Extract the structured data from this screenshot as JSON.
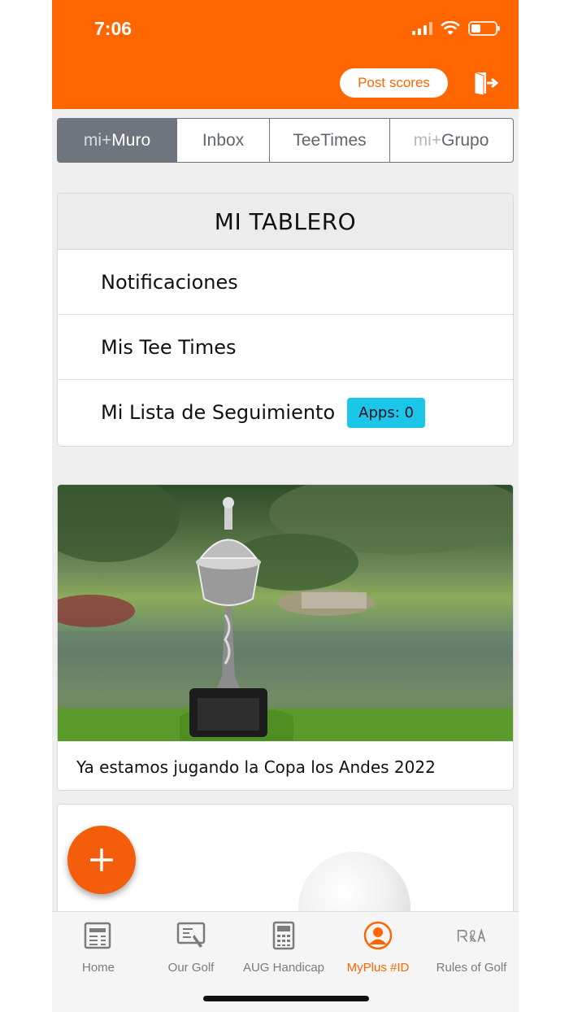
{
  "status_bar": {
    "time": "7:06"
  },
  "header": {
    "post_scores_label": "Post scores",
    "logout_icon": "logout-door-icon"
  },
  "tabs": [
    {
      "prefix": "mi+",
      "label": "Muro",
      "active": true
    },
    {
      "prefix": "",
      "label": "Inbox",
      "active": false
    },
    {
      "prefix": "",
      "label": "TeeTimes",
      "active": false
    },
    {
      "prefix": "mi+",
      "label": "Grupo",
      "active": false
    }
  ],
  "dashboard": {
    "title": "MI TABLERO",
    "items": [
      {
        "label": "Notificaciones"
      },
      {
        "label": "Mis Tee Times"
      },
      {
        "label": "Mi Lista de Seguimiento",
        "badge": "Apps: 0"
      }
    ]
  },
  "post": {
    "caption": "Ya estamos jugando la Copa los Andes 2022"
  },
  "colors": {
    "brand": "#ff6600",
    "badge": "#1bc6e8",
    "tab_active": "#6e757c"
  },
  "bottom_nav": [
    {
      "label": "Home",
      "icon": "newspaper-icon",
      "active": false
    },
    {
      "label": "Our Golf",
      "icon": "scorecard-icon",
      "active": false
    },
    {
      "label": "AUG Handicap",
      "icon": "calculator-icon",
      "active": false
    },
    {
      "label": "MyPlus #ID",
      "icon": "user-circle-icon",
      "active": true
    },
    {
      "label": "Rules of Golf",
      "icon": "randa-logo-icon",
      "active": false
    }
  ]
}
